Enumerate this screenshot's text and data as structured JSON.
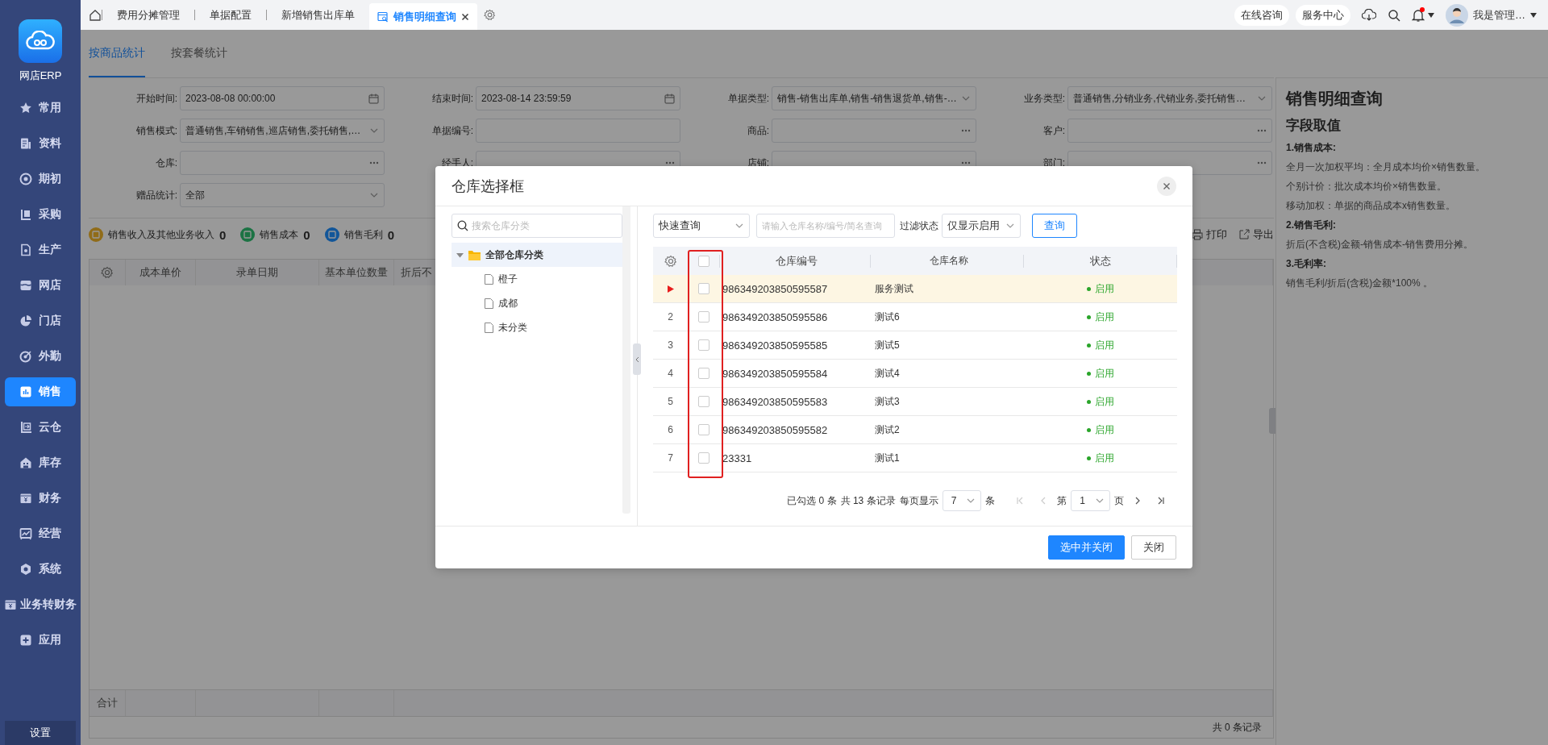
{
  "sidebar": {
    "caption": "网店ERP",
    "items": [
      {
        "label": "常用",
        "selected": false
      },
      {
        "label": "资料",
        "selected": false
      },
      {
        "label": "期初",
        "selected": false
      },
      {
        "label": "采购",
        "selected": false
      },
      {
        "label": "生产",
        "selected": false
      },
      {
        "label": "网店",
        "selected": false
      },
      {
        "label": "门店",
        "selected": false
      },
      {
        "label": "外勤",
        "selected": false
      },
      {
        "label": "销售",
        "selected": true
      },
      {
        "label": "云仓",
        "selected": false
      },
      {
        "label": "库存",
        "selected": false
      },
      {
        "label": "财务",
        "selected": false
      },
      {
        "label": "经营",
        "selected": false
      },
      {
        "label": "系统",
        "selected": false
      },
      {
        "label": "业务转财务",
        "selected": false
      },
      {
        "label": "应用",
        "selected": false
      }
    ],
    "footer": "设置"
  },
  "topbar": {
    "tabs": [
      {
        "label": "费用分摊管理",
        "selected": false
      },
      {
        "label": "单据配置",
        "selected": false
      },
      {
        "label": "新增销售出库单",
        "selected": false
      },
      {
        "label": "销售明细查询",
        "selected": true
      }
    ],
    "actions": [
      "在线咨询",
      "服务中心"
    ],
    "unread": true,
    "user": "我是管理…"
  },
  "page_tabs": [
    {
      "label": "按商品统计",
      "selected": true
    },
    {
      "label": "按套餐统计",
      "selected": false
    }
  ],
  "filters": [
    {
      "label": "开始时间:",
      "kind": "date",
      "value": "2023-08-08 00:00:00"
    },
    {
      "label": "结束时间:",
      "kind": "date",
      "value": "2023-08-14 23:59:59"
    },
    {
      "label": "单据类型:",
      "kind": "select",
      "value": "销售-销售出库单,销售-销售退货单,销售-…"
    },
    {
      "label": "业务类型:",
      "kind": "select",
      "value": "普通销售,分销业务,代销业务,委托销售…"
    },
    {
      "label": "销售模式:",
      "kind": "select",
      "value": "普通销售,车销销售,巡店销售,委托销售,…"
    },
    {
      "label": "单据编号:",
      "kind": "text"
    },
    {
      "label": "商品:",
      "kind": "picker"
    },
    {
      "label": "客户:",
      "kind": "picker"
    },
    {
      "label": "仓库:",
      "kind": "picker"
    },
    {
      "label": "经手人:",
      "kind": "picker"
    },
    {
      "label": "店铺:",
      "kind": "picker"
    },
    {
      "label": "部门:",
      "kind": "picker"
    },
    {
      "label": "赠品统计:",
      "kind": "select",
      "value": "全部"
    }
  ],
  "summary": [
    {
      "label": "销售收入及其他业务收入",
      "value": "0",
      "color": "#906c19"
    },
    {
      "label": "销售成本",
      "value": "0",
      "color": "#1c7344"
    },
    {
      "label": "销售毛利",
      "value": "0",
      "color": "#125699"
    }
  ],
  "summary_actions": [
    "打印",
    "导出"
  ],
  "table": {
    "columns": [
      "成本单价",
      "录单日期",
      "基本单位数量",
      "折后不"
    ],
    "footer_label": "合计",
    "record_count": "共 0 条记录"
  },
  "help": {
    "title": "销售明细查询",
    "subtitle": "字段取值",
    "lines": [
      {
        "kind": "heading",
        "text": "1.销售成本:"
      },
      {
        "kind": "text",
        "text": "全月一次加权平均：全月成本均价×销售数量。"
      },
      {
        "kind": "text",
        "text": "个别计价：批次成本均价×销售数量。"
      },
      {
        "kind": "text",
        "text": "移动加权：单据的商品成本x销售数量。"
      },
      {
        "kind": "heading",
        "text": "2.销售毛利:"
      },
      {
        "kind": "text",
        "text": "折后(不含税)金额-销售成本-销售费用分摊。"
      },
      {
        "kind": "heading",
        "text": "3.毛利率:"
      },
      {
        "kind": "text",
        "text": "销售毛利/折后(含税)金额*100% 。"
      }
    ]
  },
  "dialog": {
    "title": "仓库选择框",
    "tree_search": {
      "placeholder": "搜索仓库分类"
    },
    "tree": [
      {
        "label": "全部仓库分类",
        "expanded": true,
        "selected": true,
        "children": [
          {
            "label": "橙子",
            "selected": false
          },
          {
            "label": "成都",
            "selected": false
          },
          {
            "label": "未分类",
            "selected": false
          }
        ]
      }
    ],
    "query_mode": "快速查询",
    "search": {
      "placeholder": "请输入仓库名称/编号/简名查询"
    },
    "filter_label": "过滤状态",
    "filter_value": "仅显示启用",
    "query_button": "查询",
    "columns": [
      "仓库编号",
      "仓库名称",
      "状态"
    ],
    "select_all": {
      "checked": false
    },
    "rows": [
      {
        "selected": true,
        "checked": false,
        "code": "986349203850595587",
        "name": "服务测试",
        "status": "启用"
      },
      {
        "number": "2",
        "selected": false,
        "checked": false,
        "code": "986349203850595586",
        "name": "测试6",
        "status": "启用"
      },
      {
        "number": "3",
        "selected": false,
        "checked": false,
        "code": "986349203850595585",
        "name": "测试5",
        "status": "启用"
      },
      {
        "number": "4",
        "selected": false,
        "checked": false,
        "code": "986349203850595584",
        "name": "测试4",
        "status": "启用"
      },
      {
        "number": "5",
        "selected": false,
        "checked": false,
        "code": "986349203850595583",
        "name": "测试3",
        "status": "启用"
      },
      {
        "number": "6",
        "selected": false,
        "checked": false,
        "code": "986349203850595582",
        "name": "测试2",
        "status": "启用"
      },
      {
        "number": "7",
        "selected": false,
        "checked": false,
        "code": "23331",
        "name": "测试1",
        "status": "启用"
      }
    ],
    "pagination": {
      "selected_info": "已勾选 0 条",
      "total": "共 13 条记录",
      "page_size_label": "每页显示",
      "page_size": "7",
      "page_size_unit": "条",
      "page_prefix": "第",
      "page": "1",
      "page_suffix": "页",
      "nav": [
        {
          "kind": "first",
          "disabled": true
        },
        {
          "kind": "prev",
          "disabled": true
        },
        {
          "kind": "next",
          "disabled": false
        },
        {
          "kind": "last",
          "disabled": false
        }
      ]
    },
    "buttons": [
      {
        "label": "选中并关闭",
        "kind": "primary"
      },
      {
        "label": "关闭",
        "kind": "default"
      }
    ]
  }
}
